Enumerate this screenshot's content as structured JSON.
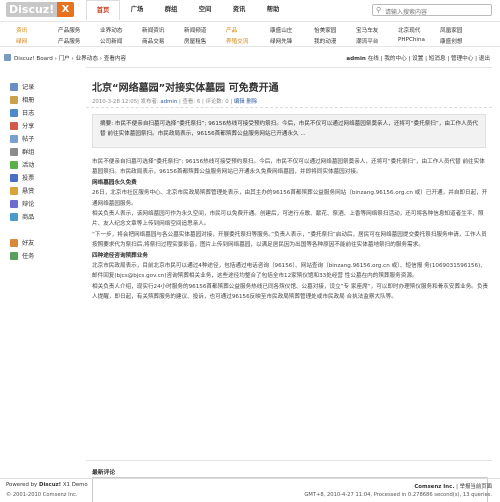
{
  "header": {
    "logo_text": "Discuz!",
    "logo_x": "X",
    "search_placeholder": "请输入搜索内容",
    "nav": [
      "首页",
      "广场",
      "群组",
      "空间",
      "资讯",
      "帮助"
    ]
  },
  "subnav": {
    "row1": [
      "资讯",
      "产品服务",
      "业界动态",
      "新闻资讯",
      "新闻频道",
      "产品",
      "康盛山庄",
      "怡美家园",
      "宝马车友",
      "北京现代",
      "凤凰家园"
    ],
    "row2": [
      "绿网",
      "产品服务",
      "公司新闻",
      "商品交易",
      "房屋租售",
      "养殖交流",
      "绿网先锋",
      "我的动漫",
      "潮流平台",
      "PHPChina",
      "康盛创想"
    ]
  },
  "crumb": {
    "path": "Discuz! Board › 门户 › 业界动态 › 查看内容",
    "user": "admin",
    "links": "在线 | 我的中心 | 设置 | 短消息 | 管理中心 | 退出"
  },
  "sidebar": [
    "记录",
    "相册",
    "日志",
    "分享",
    "帖子",
    "群组",
    "活动",
    "投票",
    "悬赏",
    "辩论",
    "商品",
    "好友",
    "任务"
  ],
  "article": {
    "title": "北京“网络墓园”对接实体墓园 可免费开通",
    "date": "2010-3-28 12:05",
    "author_pre": "| 发布者: ",
    "author": "admin",
    "stats": " | 查看: 6 | 评论数: 0 | ",
    "edit": "编辑",
    "del": "删除",
    "summary": "摘要: 市民不便亲自扫墓可选择“委托祭扫”; 96156热线可接受预约祭扫。今后，市民不仅可以通过网络墓园祭奠亲人，还将可“委托祭扫”，由工作人员代替 前往实体墓园祭扫。市民政局表示，96156首都殡葬公益服务网站已开通永久 ...",
    "paras": [
      {
        "t": "p",
        "v": "市民不便亲自扫墓可选择“委托祭扫”; 96156热线可接受预约祭扫。今后，市民不仅可以通过网络墓园祭奠亲人，还将可“委托祭扫”，由工作人员代替 前往实体墓园祭扫。市民政局表示，96156首都殡葬公益服务网站已开通永久免费网络墓园，并即将同实体墓园对接。"
      },
      {
        "t": "h",
        "v": "网络墓园永久免费"
      },
      {
        "t": "p",
        "v": "26日，北京市社区服务中心、北京市民政局殡葬管理处表示，由其主办的96156首都殡葬公益服务网站（binzang.96156.org.cn 或）已开通，并自即日起，开通网络墓园服务。"
      },
      {
        "t": "p",
        "v": "相关负责人表示，该网络墓园可作为永久空间，市民可以免费开通。创建后，可进行点歌、献花、祭酒、上香等网络祭扫活动，还可将各种信息知道者生平、照片、友人纪念文章等上传到网络空间追思亲人。"
      },
      {
        "t": "p",
        "v": "“下一步，将会把网络墓园与各公墓实体墓园对接，开展委托祭扫等服务。”负责人表示，“委托祭扫”启动后，居民可在网络墓园提交委托祭扫服务申请，工作人员按照要求代为祭扫后,将祭扫过程实景影音，图片上传到网络墓园，以满足居民因为出国等各种原因不能前往实体墓地祭扫的服务需求。"
      },
      {
        "t": "h",
        "v": "四种途径咨询殡葬业务"
      },
      {
        "t": "p",
        "v": "北京市民政局表示，目前北京市民可以通过4种途径，包括通过电话咨询（96156）、网站查询（binzang.96156.org.cn 或）、短信报 务(1069031596156)、邮件回复(bjcs@bjcs.gov.cn)咨询殡葬相关业务，这些途径均整合了包括全市12家殡仪馆和33处经营 性公墓在内的殡葬服务资源。"
      },
      {
        "t": "p",
        "v": "相关负责人介绍，现实行24小时服务的96156首都殡葬公益服务热线已同各殡仪馆、公墓对接，设立“专 家座席”，可以即时办理殡仪服务和骨灰安葬业务。负责人提醒，即日起，有关殡葬服务的建议、投诉，也可通过96156反映至市民政局殡葬管理处或市民政局 合执法监察大队等。"
      }
    ]
  },
  "comment": {
    "label": "最新评论",
    "button": "评论"
  },
  "footer": {
    "powered_pre": "Powered by ",
    "powered": "Discuz!",
    "powered_post": " X1 Demo",
    "copyright": "© 2001-2010 Comsenz Inc.",
    "company": "Comsenz Inc.",
    "right_links": " | 举报当前页面",
    "timeinfo": "GMT+8, 2010-4-27 11:04, Processed in 0.278686 second(s), 13 queries."
  },
  "colors": {
    "accent": "#c4381a",
    "link": "#2b5aa0",
    "subnav_hi": "#d6820c"
  }
}
